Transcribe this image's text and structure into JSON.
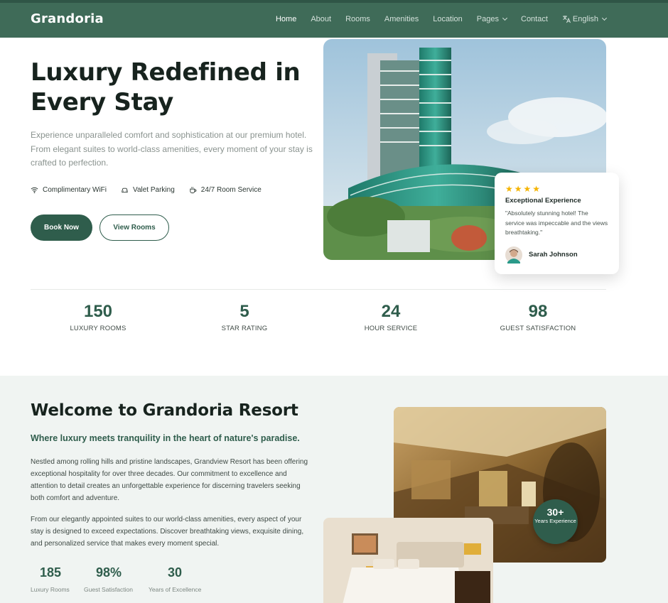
{
  "nav": {
    "logo": "Grandoria",
    "items": [
      "Home",
      "About",
      "Rooms",
      "Amenities",
      "Location",
      "Pages",
      "Contact"
    ],
    "language": "English"
  },
  "hero": {
    "title": "Luxury Redefined in Every Stay",
    "description": "Experience unparalleled comfort and sophistication at our premium hotel. From elegant suites to world-class amenities, every moment of your stay is crafted to perfection.",
    "features": [
      "Complimentary WiFi",
      "Valet Parking",
      "24/7 Room Service"
    ],
    "primary_button": "Book Now",
    "secondary_button": "View Rooms"
  },
  "review": {
    "stars": "★★★★",
    "title": "Exceptional Experience",
    "text": "\"Absolutely stunning hotel! The service was impeccable and the views breathtaking.\"",
    "name": "Sarah Johnson"
  },
  "stats": [
    {
      "value": "150",
      "label": "LUXURY ROOMS"
    },
    {
      "value": "5",
      "label": "STAR RATING"
    },
    {
      "value": "24",
      "label": "HOUR SERVICE"
    },
    {
      "value": "98",
      "label": "GUEST SATISFACTION"
    }
  ],
  "welcome": {
    "title": "Welcome to Grandoria Resort",
    "subtitle": "Where luxury meets tranquility in the heart of nature's paradise.",
    "paragraph1": "Nestled among rolling hills and pristine landscapes, Grandview Resort has been offering exceptional hospitality for over three decades. Our commitment to excellence and attention to detail creates an unforgettable experience for discerning travelers seeking both comfort and adventure.",
    "paragraph2": "From our elegantly appointed suites to our world-class amenities, every aspect of your stay is designed to exceed expectations. Discover breathtaking views, exquisite dining, and personalized service that makes every moment special.",
    "stats": [
      {
        "value": "185",
        "label": "Luxury Rooms"
      },
      {
        "value": "98%",
        "label": "Guest Satisfaction"
      },
      {
        "value": "30",
        "label": "Years of Excellence"
      }
    ],
    "badge": {
      "value": "30+",
      "label": "Years Experience"
    }
  },
  "colors": {
    "primary": "#2f5d4c",
    "nav": "#3f6b58",
    "star": "#f5b400",
    "section_bg": "#f0f4f2"
  }
}
